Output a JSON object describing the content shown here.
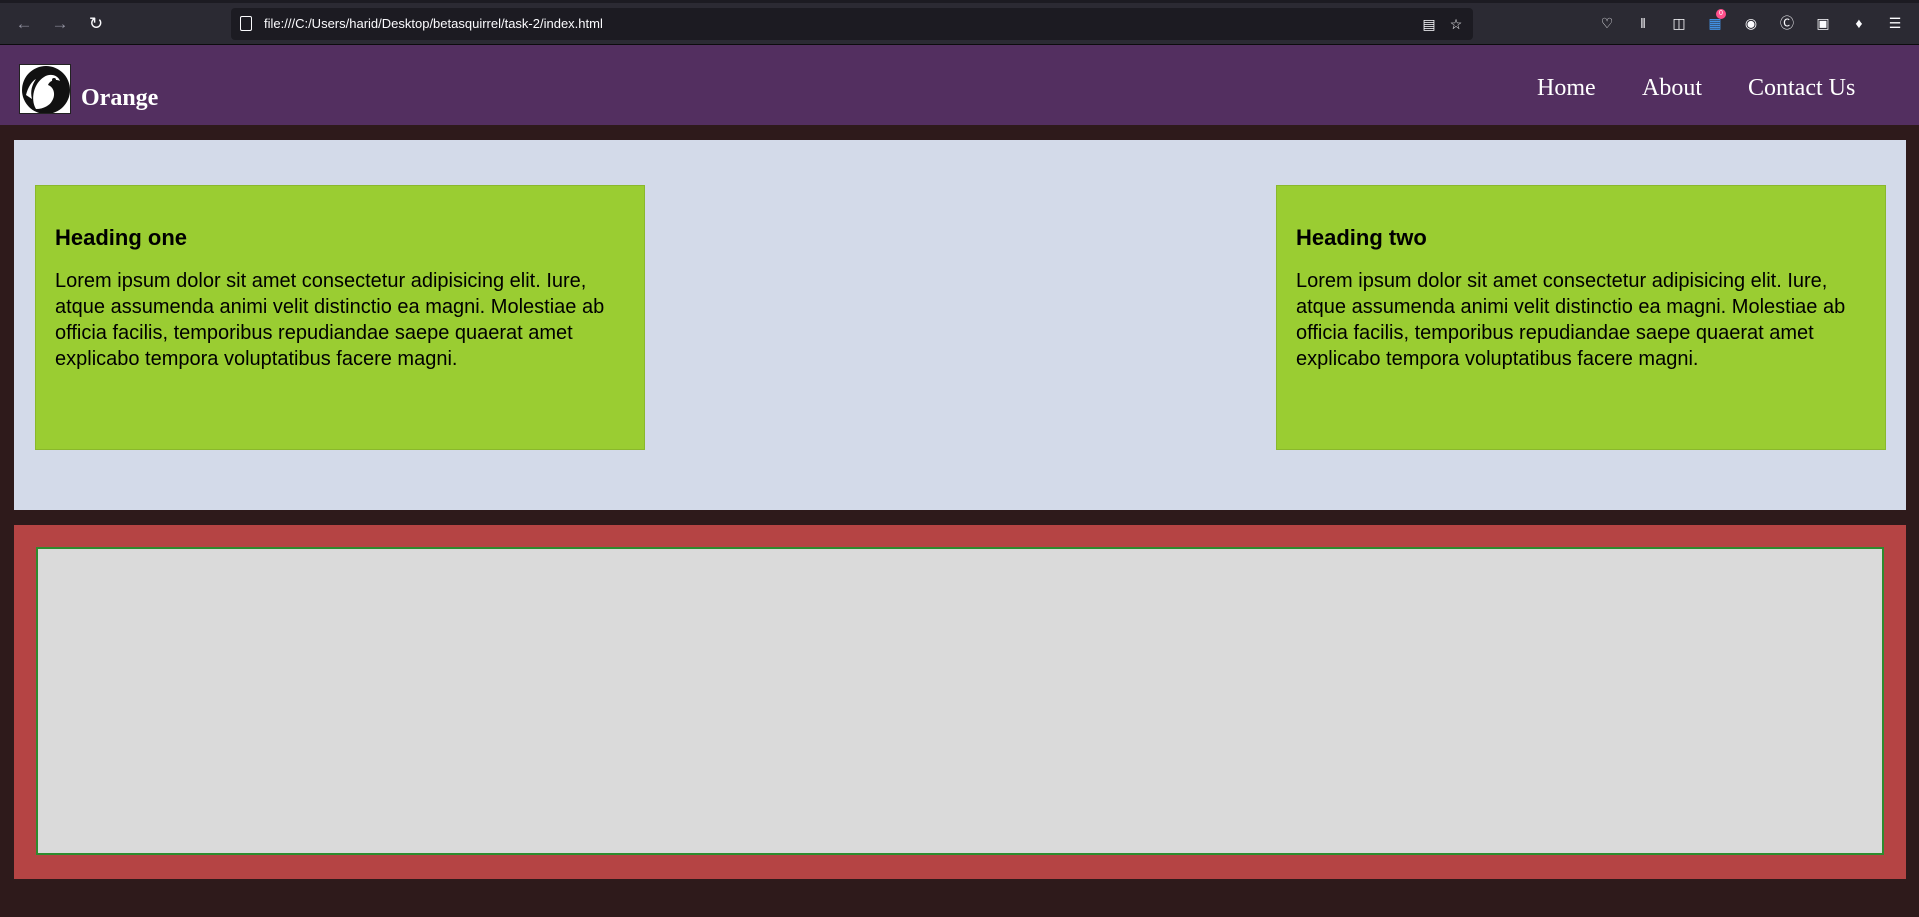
{
  "browser": {
    "url": "file:///C:/Users/harid/Desktop/betasquirrel/task-2/index.html",
    "badge_count": "0",
    "icons": [
      "back-arrow-icon",
      "forward-arrow-icon",
      "reload-icon",
      "reader-view-icon",
      "bookmark-star-icon",
      "pocket-icon",
      "library-icon",
      "sidebar-icon",
      "extension-icon",
      "extension-icon",
      "extension-icon",
      "extension-icon",
      "extensions-icon",
      "menu-icon"
    ]
  },
  "site": {
    "brand": "Orange",
    "nav": [
      {
        "label": "Home"
      },
      {
        "label": "About"
      },
      {
        "label": "Contact Us"
      }
    ]
  },
  "hero": {
    "cards": [
      {
        "heading": "Heading one",
        "body": "Lorem ipsum dolor sit amet consectetur adipisicing elit. Iure, atque assumenda animi velit distinctio ea magni. Molestiae ab officia facilis, temporibus repudiandae saepe quaerat amet explicabo tempora voluptatibus facere magni."
      },
      {
        "heading": "Heading two",
        "body": "Lorem ipsum dolor sit amet consectetur adipisicing elit. Iure, atque assumenda animi velit distinctio ea magni. Molestiae ab officia facilis, temporibus repudiandae saepe quaerat amet explicabo tempora voluptatibus facere magni."
      }
    ]
  },
  "colors": {
    "page_background": "#2e1a1b",
    "header_background": "#532f60",
    "hero_background": "#d3dae9",
    "card_background": "#9acd32",
    "lower_section_background": "#b54444",
    "lower_inner_background": "#dadada",
    "lower_inner_border": "#2e8b2e"
  }
}
